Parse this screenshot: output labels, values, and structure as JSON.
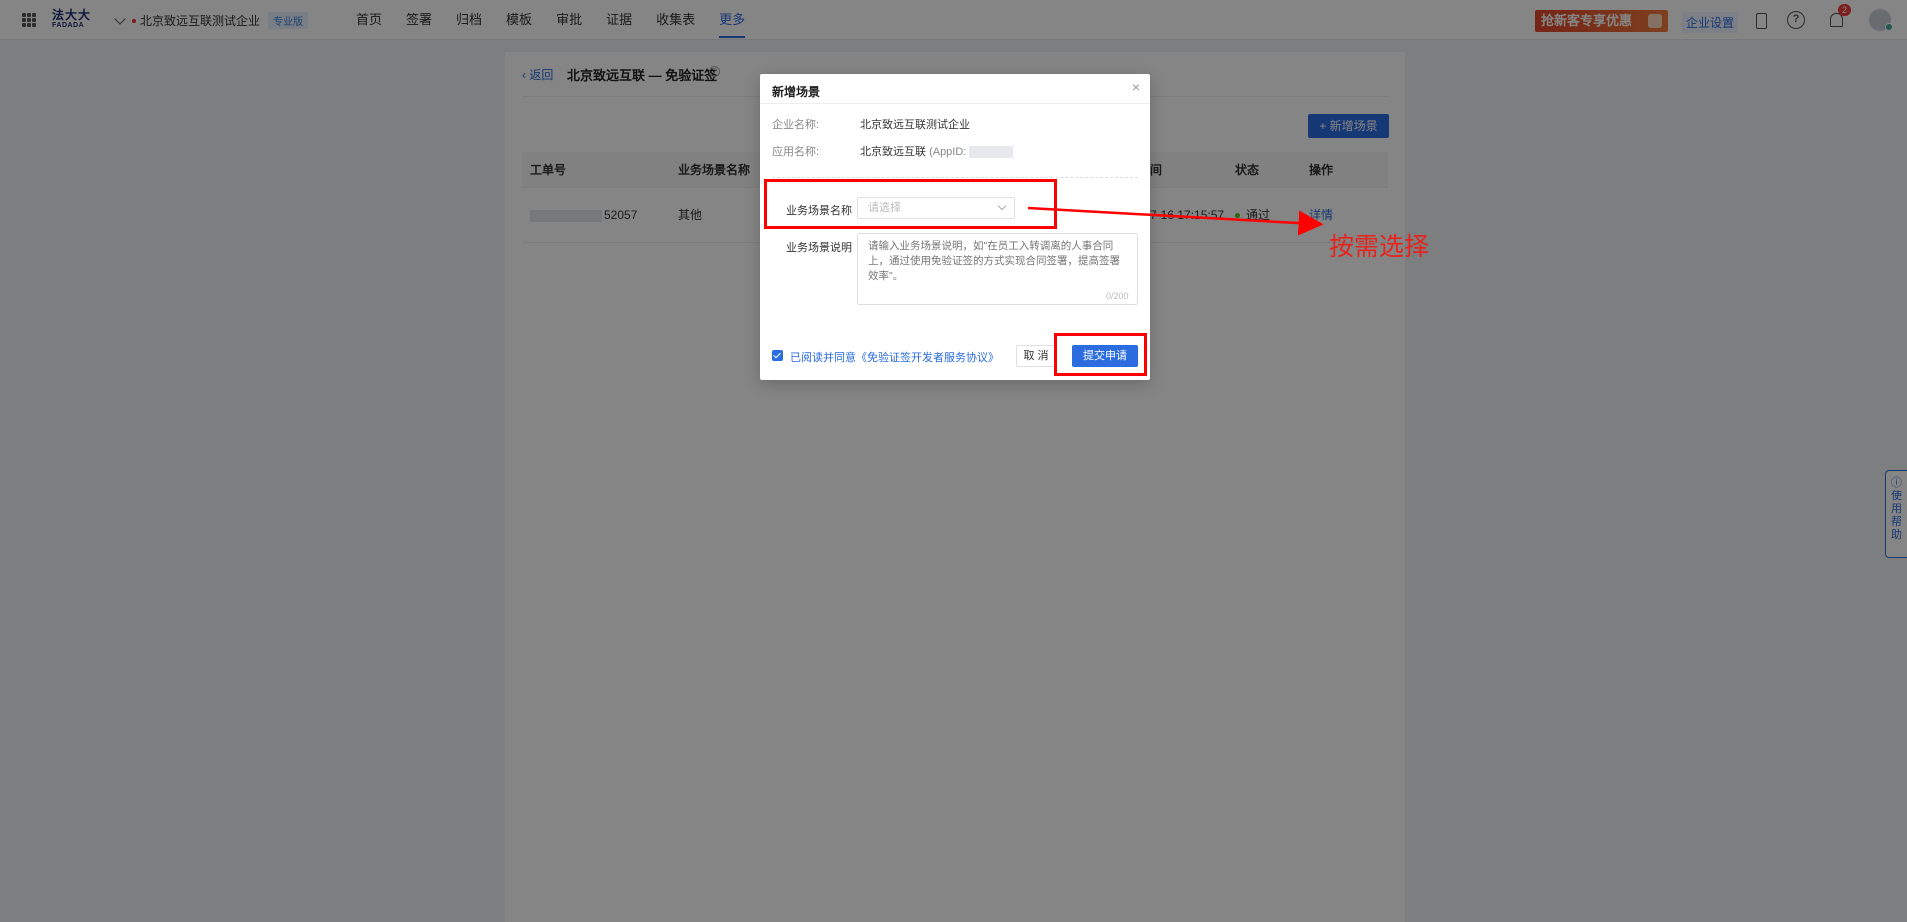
{
  "topbar": {
    "logo_cn": "法大大",
    "logo_en": "FADADA",
    "company_name": "北京致远互联测试企业",
    "plan_badge": "专业版",
    "nav": [
      "首页",
      "签署",
      "归档",
      "模板",
      "审批",
      "证据",
      "收集表",
      "更多"
    ],
    "active_nav": "更多",
    "promo": "抢新客专享优惠",
    "enterprise_settings": "企业设置",
    "help": "?",
    "notification_count": "2"
  },
  "page": {
    "back": "返回",
    "title": "北京致远互联 — 免验证签",
    "title_help": "?",
    "add_scene": "+ 新增场景",
    "table": {
      "headers": [
        "工单号",
        "业务场景名称",
        "间",
        "状态",
        "操作"
      ],
      "rows": [
        {
          "id_suffix": "52057",
          "scene": "其他",
          "time": "7-16 17:15:57",
          "status": "通过",
          "action": "详情"
        }
      ]
    },
    "help_tab": "使用帮助"
  },
  "dialog": {
    "title": "新增场景",
    "close": "×",
    "company_label": "企业名称:",
    "company_value": "北京致远互联测试企业",
    "app_label": "应用名称:",
    "app_value": "北京致远互联",
    "app_id_prefix": "(AppID: ",
    "scene_name_label": "业务场景名称",
    "scene_name_placeholder": "请选择",
    "scene_desc_label": "业务场景说明",
    "scene_desc_placeholder": "请输入业务场景说明，如\"在员工入转调离的人事合同上，通过使用免验证签的方式实现合同签署，提高签署效率\"。",
    "counter": "0/200",
    "agree": "已阅读并同意《免验证签开发者服务协议》",
    "cancel": "取 消",
    "submit": "提交申请"
  },
  "annotation": {
    "text": "按需选择",
    "color": "#e8231c"
  },
  "colors": {
    "primary": "#2b6cde",
    "annotation_red": "#ff0000",
    "promo": "#e2452b"
  }
}
